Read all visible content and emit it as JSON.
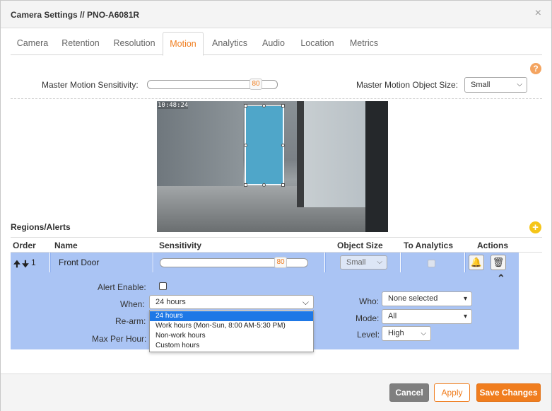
{
  "dialog": {
    "title": "Camera Settings // PNO-A6081R",
    "close": "×"
  },
  "tabs": [
    "Camera",
    "Retention",
    "Resolution",
    "Motion",
    "Analytics",
    "Audio",
    "Location",
    "Metrics"
  ],
  "active_tab": "Motion",
  "motion": {
    "master_sensitivity_label": "Master Motion Sensitivity:",
    "master_sensitivity_value": "80",
    "master_object_size_label": "Master Motion Object Size:",
    "master_object_size_value": "Small",
    "help_icon": "?"
  },
  "preview": {
    "timestamp": "10:48:24"
  },
  "regions": {
    "title": "Regions/Alerts",
    "headers": {
      "order": "Order",
      "name": "Name",
      "sensitivity": "Sensitivity",
      "object_size": "Object Size",
      "to_analytics": "To Analytics",
      "actions": "Actions"
    },
    "rows": [
      {
        "order": "1",
        "name": "Front Door",
        "sensitivity": "80",
        "object_size": "Small",
        "to_analytics": false
      }
    ]
  },
  "alert": {
    "alert_enable_label": "Alert Enable:",
    "when_label": "When:",
    "when_value": "24 hours",
    "rearm_label": "Re-arm:",
    "max_per_hour_label": "Max Per Hour:",
    "who_label": "Who:",
    "who_value": "None selected",
    "mode_label": "Mode:",
    "mode_value": "All",
    "level_label": "Level:",
    "level_value": "High",
    "when_options": [
      "24 hours",
      "Work hours (Mon-Sun, 8:00 AM-5:30 PM)",
      "Non-work hours",
      "Custom hours"
    ]
  },
  "footer": {
    "cancel": "Cancel",
    "apply": "Apply",
    "save": "Save Changes"
  },
  "colors": {
    "accent": "#f07d1e",
    "row_highlight": "#aac4f4",
    "dropdown_select": "#1e78e6"
  }
}
